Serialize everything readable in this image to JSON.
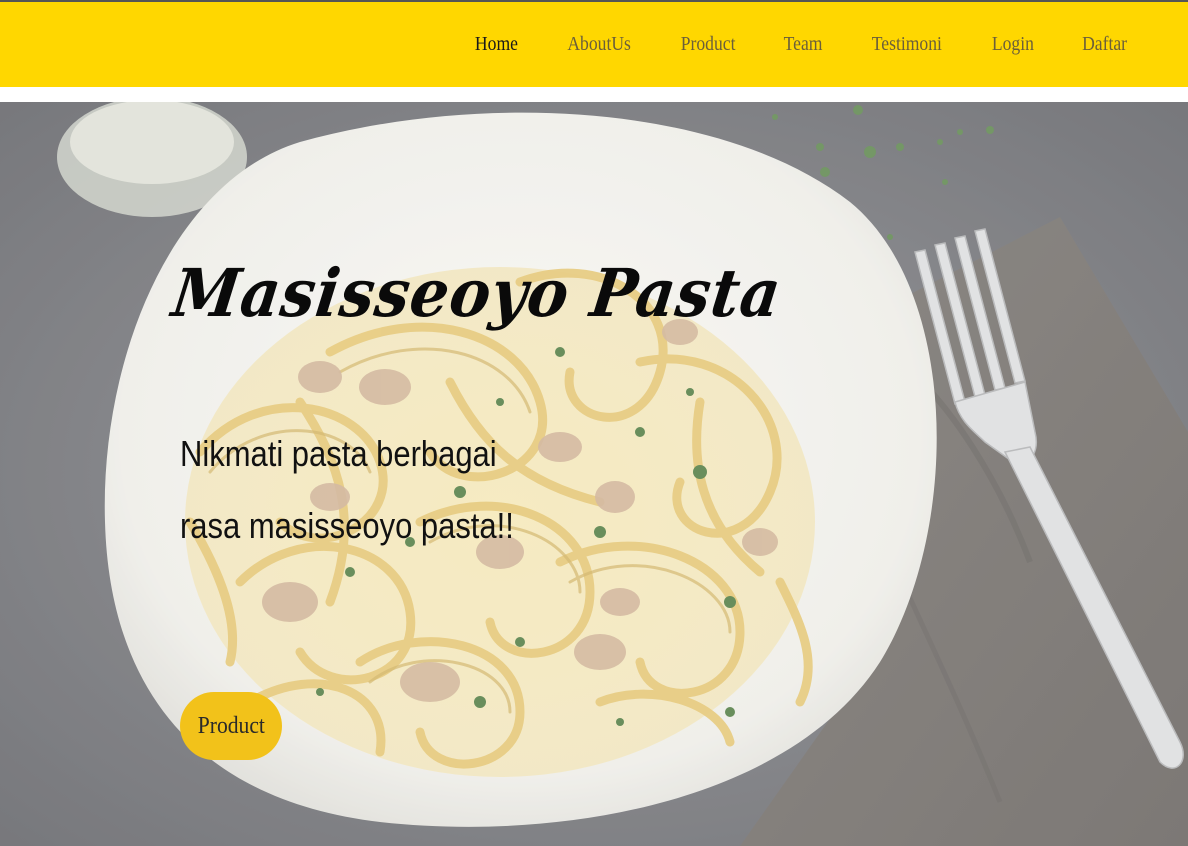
{
  "nav": {
    "items": [
      {
        "label": "Home",
        "active": true
      },
      {
        "label": "AboutUs",
        "active": false
      },
      {
        "label": "Product",
        "active": false
      },
      {
        "label": "Team",
        "active": false
      },
      {
        "label": "Testimoni",
        "active": false
      },
      {
        "label": "Login",
        "active": false
      },
      {
        "label": "Daftar",
        "active": false
      }
    ]
  },
  "hero": {
    "title": "Masisseoyo Pasta",
    "subtitle": "Nikmati pasta berbagai rasa masisseoyo pasta!!",
    "button_label": "Product",
    "image": "pasta-plate-photo"
  },
  "colors": {
    "navbar_bg": "#ffd700",
    "button_bg": "#f2c21a",
    "nav_text": "#6b5f3a",
    "nav_active_text": "#1a1a1a"
  }
}
